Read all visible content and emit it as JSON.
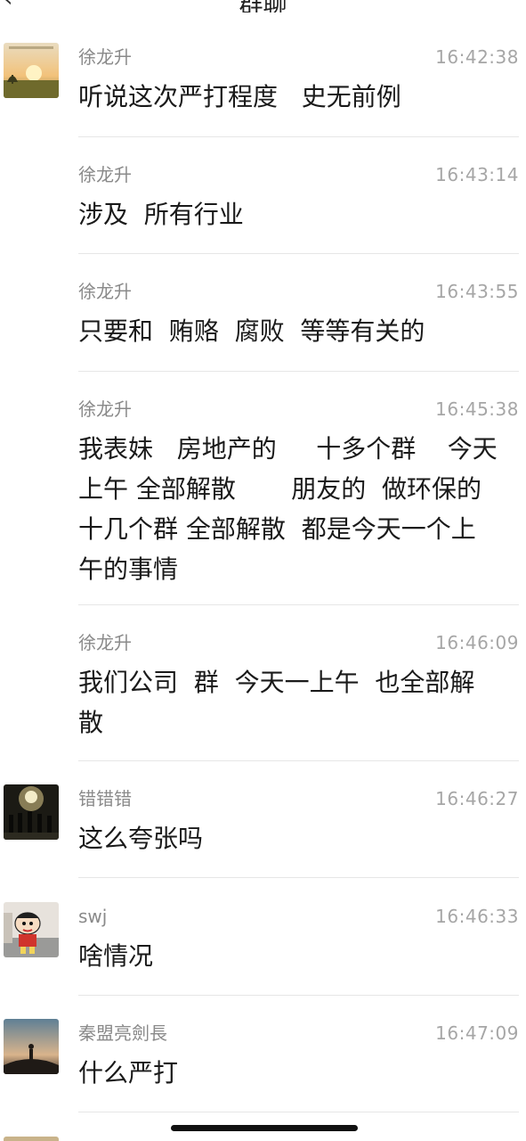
{
  "header": {
    "back_icon": "chevron-left-icon",
    "title": "群聊"
  },
  "messages": [
    {
      "name": "徐龙升",
      "time": "16:42:38",
      "text": "听说这次严打程度   史无前例",
      "avatar": "sunset-field-avatar"
    },
    {
      "name": "徐龙升",
      "time": "16:43:14",
      "text": "涉及  所有行业"
    },
    {
      "name": "徐龙升",
      "time": "16:43:55",
      "text": "只要和  贿赂  腐败  等等有关的"
    },
    {
      "name": "徐龙升",
      "time": "16:45:38",
      "text": "我表妹   房地产的     十多个群    今天\n上午 全部解散       朋友的  做环保的\n十几个群 全部解散  都是今天一个上\n午的事情"
    },
    {
      "name": "徐龙升",
      "time": "16:46:09",
      "text": "我们公司  群  今天一上午  也全部解\n散"
    },
    {
      "name": "错错错",
      "time": "16:46:27",
      "text": "这么夸张吗",
      "avatar": "concert-crowd-avatar"
    },
    {
      "name": "swj",
      "time": "16:46:33",
      "text": "啥情况",
      "avatar": "cartoon-boy-avatar"
    },
    {
      "name": "秦盟亮劍長",
      "time": "16:47:09",
      "text": "什么严打",
      "avatar": "silhouette-hill-avatar"
    }
  ]
}
